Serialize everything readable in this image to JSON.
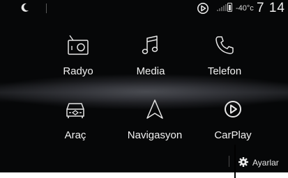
{
  "status_bar": {
    "moon_icon": "crescent-moon-icon",
    "carplay_icon": "carplay-icon",
    "signal_icon": "signal-bars-icon",
    "phone_icon": "phone-battery-icon",
    "temperature": "-40°c",
    "time": "7 14"
  },
  "apps": [
    {
      "label": "Radyo",
      "icon": "radio-icon"
    },
    {
      "label": "Media",
      "icon": "music-note-icon"
    },
    {
      "label": "Telefon",
      "icon": "phone-icon"
    },
    {
      "label": "Araç",
      "icon": "car-icon"
    },
    {
      "label": "Navigasyon",
      "icon": "navigation-arrow-icon"
    },
    {
      "label": "CarPlay",
      "icon": "carplay-icon"
    }
  ],
  "settings": {
    "label": "Ayarlar",
    "icon": "gear-icon"
  },
  "colors": {
    "background": "#060708",
    "text": "#f2f2f2",
    "icon": "#e6e6e6"
  }
}
